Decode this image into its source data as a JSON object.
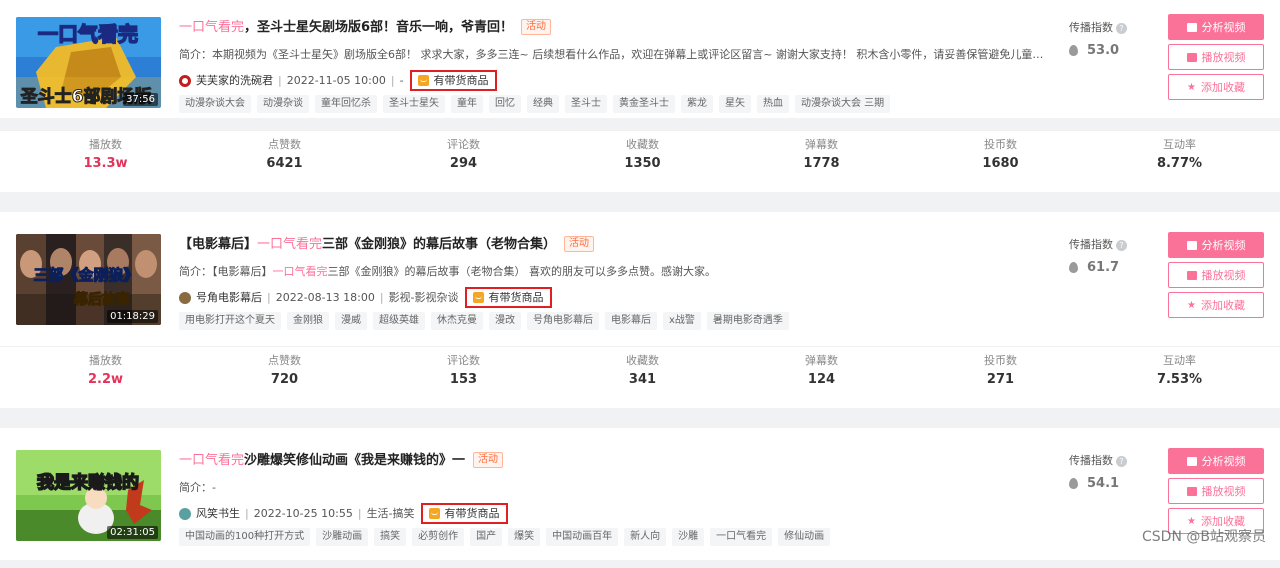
{
  "videos": [
    {
      "thumb_text_top": "一口气看完",
      "thumb_text_bottom": "圣斗士6部剧场版",
      "duration": "37:56",
      "title_hl": "一口气看完",
      "title_rest": "，圣斗士星矢剧场版6部！音乐一响，爷青回！",
      "activity": "活动",
      "intro_prefix": "简介：",
      "intro_hl": "",
      "intro_rest": "本期视频为《圣斗士星矢》剧场版全6部！ 求求大家，多多三连~ 后续想看什么作品，欢迎在弹幕上或评论区留言~ 谢谢大家支持！ 积木含小零件，请妥善保管避免儿童误...",
      "up": "芙芙家的洗碗君",
      "date": "2022-11-05 10:00",
      "category": "-",
      "goods": "有带货商品",
      "tags": [
        "动漫杂谈大会",
        "动漫杂谈",
        "童年回忆杀",
        "圣斗士星矢",
        "童年",
        "回忆",
        "经典",
        "圣斗士",
        "黄金圣斗士",
        "紫龙",
        "星矢",
        "热血",
        "动漫杂谈大会 三期"
      ],
      "spread_label": "传播指数",
      "score": "53.0",
      "buttons": [
        "分析视频",
        "播放视频",
        "添加收藏"
      ],
      "stats": [
        {
          "k": "播放数",
          "v": "13.3w"
        },
        {
          "k": "点赞数",
          "v": "6421"
        },
        {
          "k": "评论数",
          "v": "294"
        },
        {
          "k": "收藏数",
          "v": "1350"
        },
        {
          "k": "弹幕数",
          "v": "1778"
        },
        {
          "k": "投币数",
          "v": "1680"
        },
        {
          "k": "互动率",
          "v": "8.77%"
        }
      ]
    },
    {
      "thumb_text_top": "三部《金刚狼》",
      "thumb_text_bottom": "幕后故事",
      "duration": "01:18:29",
      "title_prefix": "【电影幕后】",
      "title_hl": "一口气看完",
      "title_rest": "三部《金刚狼》的幕后故事（老物合集）",
      "activity": "活动",
      "intro_prefix": "简介：【电影幕后】",
      "intro_hl": "一口气看完",
      "intro_rest": "三部《金刚狼》的幕后故事（老物合集） 喜欢的朋友可以多多点赞。感谢大家。",
      "up": "号角电影幕后",
      "date": "2022-08-13 18:00",
      "category": "影视-影视杂谈",
      "goods": "有带货商品",
      "tags": [
        "用电影打开这个夏天",
        "金刚狼",
        "漫威",
        "超级英雄",
        "休杰克曼",
        "漫改",
        "号角电影幕后",
        "电影幕后",
        "x战警",
        "暑期电影奇遇季"
      ],
      "spread_label": "传播指数",
      "score": "61.7",
      "buttons": [
        "分析视频",
        "播放视频",
        "添加收藏"
      ],
      "stats": [
        {
          "k": "播放数",
          "v": "2.2w"
        },
        {
          "k": "点赞数",
          "v": "720"
        },
        {
          "k": "评论数",
          "v": "153"
        },
        {
          "k": "收藏数",
          "v": "341"
        },
        {
          "k": "弹幕数",
          "v": "124"
        },
        {
          "k": "投币数",
          "v": "271"
        },
        {
          "k": "互动率",
          "v": "7.53%"
        }
      ]
    },
    {
      "thumb_text_top": "我是来赚钱的",
      "thumb_text_bottom": "",
      "duration": "02:31:05",
      "title_hl": "一口气看完",
      "title_rest": "沙雕爆笑修仙动画《我是来赚钱的》一",
      "activity": "活动",
      "intro_prefix": "简介：-",
      "intro_hl": "",
      "intro_rest": "",
      "up": "风笑书生",
      "date": "2022-10-25 10:55",
      "category": "生活-搞笑",
      "goods": "有带货商品",
      "tags": [
        "中国动画的100种打开方式",
        "沙雕动画",
        "搞笑",
        "必剪创作",
        "国产",
        "爆笑",
        "中国动画百年",
        "新人向",
        "沙雕",
        "一口气看完",
        "修仙动画"
      ],
      "spread_label": "传播指数",
      "score": "54.1",
      "buttons": [
        "分析视频",
        "播放视频",
        "添加收藏"
      ]
    }
  ],
  "watermark": "CSDN @B站观察员"
}
